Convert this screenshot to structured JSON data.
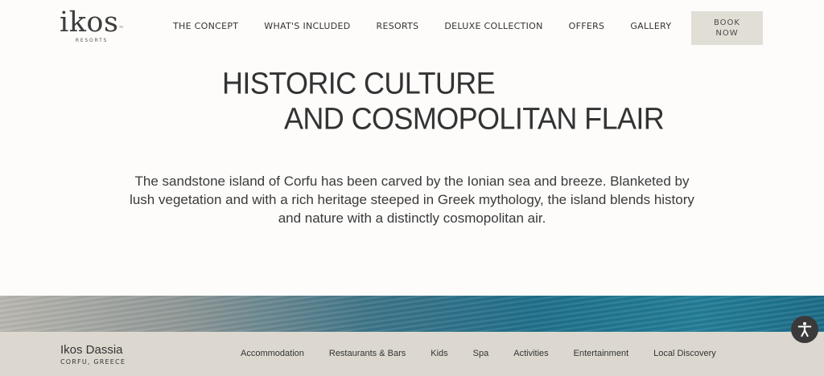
{
  "header": {
    "logo_word": "ikos",
    "logo_sub": "RESORTS",
    "nav": [
      "THE CONCEPT",
      "WHAT'S INCLUDED",
      "RESORTS",
      "DELUXE COLLECTION",
      "OFFERS",
      "GALLERY"
    ],
    "book_line1": "BOOK",
    "book_line2": "NOW"
  },
  "main": {
    "headline_line1": "HISTORIC CULTURE",
    "headline_line2": "AND COSMOPOLITAN FLAIR",
    "intro": "The sandstone island of Corfu has been carved by the Ionian sea and breeze. Blanketed by lush vegetation and with a rich heritage steeped in Greek mythology, the island blends history and nature with a distinctly cosmopolitan air."
  },
  "subbar": {
    "resort_name": "Ikos Dassia",
    "resort_location": "CORFU, GREECE",
    "items": [
      "Accommodation",
      "Restaurants & Bars",
      "Kids",
      "Spa",
      "Activities",
      "Entertainment",
      "Local Discovery"
    ]
  },
  "icons": {
    "accessibility": "accessibility-icon"
  },
  "colors": {
    "button_bg": "#e1ded6",
    "subbar_bg": "#dcd8cf",
    "sea": "#1f6f8a"
  }
}
